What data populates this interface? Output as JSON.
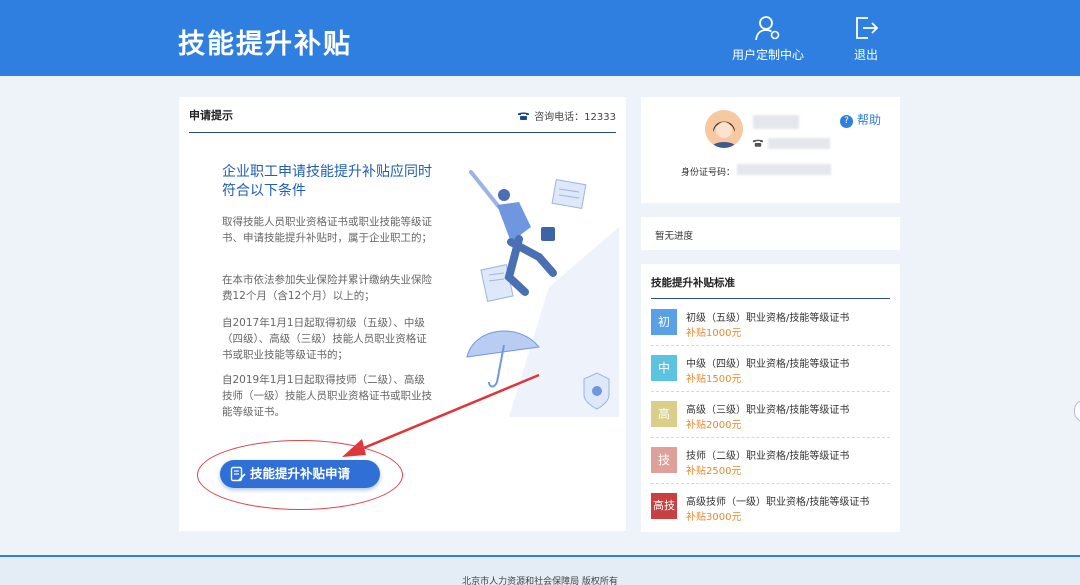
{
  "header": {
    "title": "技能提升补贴",
    "user_center": "用户定制中心",
    "logout": "退出"
  },
  "apply_panel": {
    "heading": "申请提示",
    "phone_label": "咨询电话：12333",
    "cond_title": "企业职工申请技能提升补贴应同时符合以下条件",
    "conditions": [
      "取得技能人员职业资格证书或职业技能等级证书、申请技能提升补贴时，属于企业职工的；",
      "在本市依法参加失业保险并累计缴纳失业保险费12个月（含12个月）以上的；",
      "自2017年1月1日起取得初级（五级）、中级（四级）、高级（三级）技能人员职业资格证书或职业技能等级证书的；",
      "自2019年1月1日起取得技师（二级）、高级技师（一级）技能人员职业资格证书或职业技能等级证书。"
    ],
    "apply_button": "技能提升补贴申请"
  },
  "profile": {
    "help": "帮助",
    "id_label": "身份证号码："
  },
  "progress": {
    "text": "暂无进度"
  },
  "standard": {
    "heading": "技能提升补贴标准",
    "levels": [
      {
        "badge": "初",
        "color": "#5aa0e6",
        "name": "初级（五级）职业资格/技能等级证书",
        "amount": "补贴1000元"
      },
      {
        "badge": "中",
        "color": "#5cc4e0",
        "name": "中级（四级）职业资格/技能等级证书",
        "amount": "补贴1500元"
      },
      {
        "badge": "高",
        "color": "#d9cf8a",
        "name": "高级（三级）职业资格/技能等级证书",
        "amount": "补贴2000元"
      },
      {
        "badge": "技",
        "color": "#e0a09a",
        "name": "技师（二级）职业资格/技能等级证书",
        "amount": "补贴2500元"
      },
      {
        "badge": "高技",
        "color": "#c8403f",
        "name": "高级技师（一级）职业资格/技能等级证书",
        "amount": "补贴3000元"
      }
    ]
  },
  "footer": {
    "text": "北京市人力资源和社会保障局 版权所有"
  }
}
